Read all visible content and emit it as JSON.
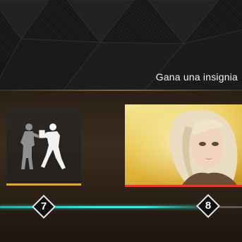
{
  "header": {
    "title": "Gana una insignia"
  },
  "rewards": [
    {
      "tier": "7",
      "icon": "wrestlers-icon",
      "accent": "#d9a93a"
    },
    {
      "tier": "8",
      "icon": "character-portrait",
      "accent": "#e03c2a"
    }
  ],
  "progress": {
    "fraction": 0.86
  },
  "colors": {
    "progress": "#3ce6d8",
    "card_gold": "#e8c64d",
    "band_brown": "#3a2c1e"
  }
}
